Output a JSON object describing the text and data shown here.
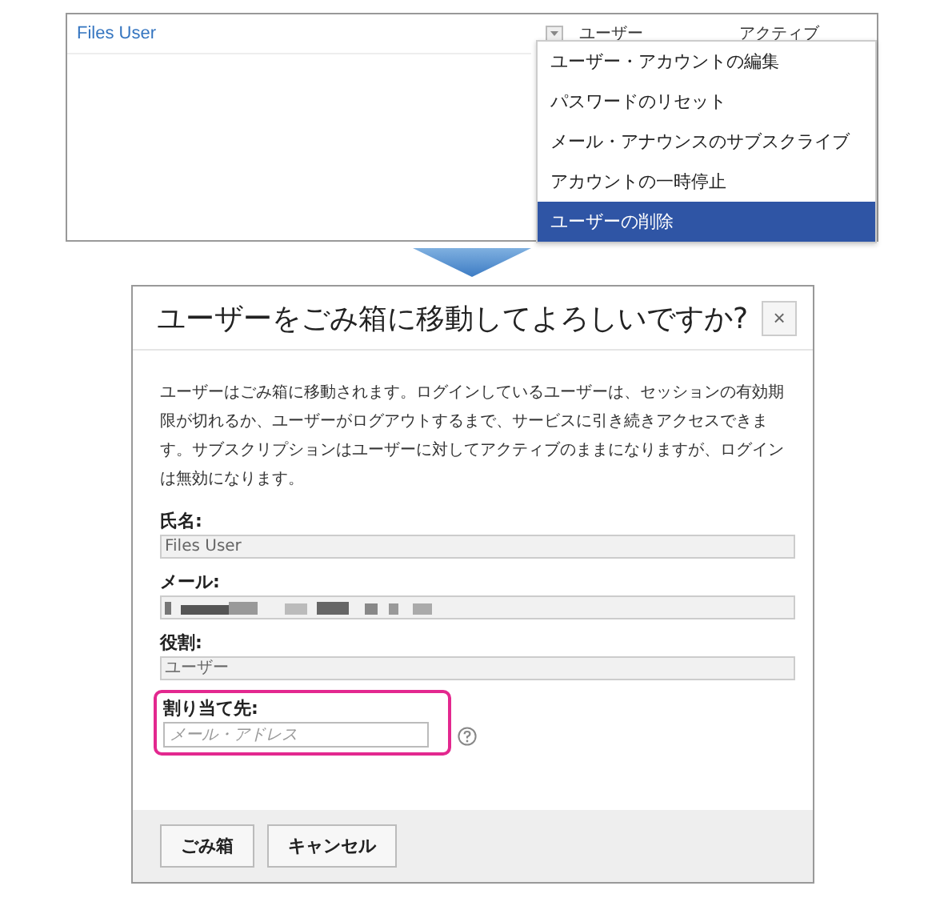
{
  "user_list": {
    "name_link": "Files User",
    "columns": [
      "ユーザー",
      "アクティブ"
    ]
  },
  "action_menu": {
    "items": [
      {
        "label": "ユーザー・アカウントの編集",
        "selected": false
      },
      {
        "label": "パスワードのリセット",
        "selected": false
      },
      {
        "label": "メール・アナウンスのサブスクライブ",
        "selected": false
      },
      {
        "label": "アカウントの一時停止",
        "selected": false
      },
      {
        "label": "ユーザーの削除",
        "selected": true
      }
    ]
  },
  "dialog": {
    "title": "ユーザーをごみ箱に移動してよろしいですか?",
    "close": "×",
    "message": "ユーザーはごみ箱に移動されます。ログインしているユーザーは、セッションの有効期限が切れるか、ユーザーがログアウトするまで、サービスに引き続きアクセスできます。サブスクリプションはユーザーに対してアクティブのままになりますが、ログインは無効になります。",
    "fields": [
      {
        "kind": "readonly",
        "label": "氏名:",
        "value": "Files User"
      },
      {
        "kind": "redacted",
        "label": "メール:"
      },
      {
        "kind": "readonly",
        "label": "役割:",
        "value": "ユーザー"
      },
      {
        "kind": "input",
        "label": "割り当て先:",
        "placeholder": "メール・アドレス",
        "highlighted": true
      }
    ],
    "buttons": [
      "ごみ箱",
      "キャンセル"
    ]
  }
}
